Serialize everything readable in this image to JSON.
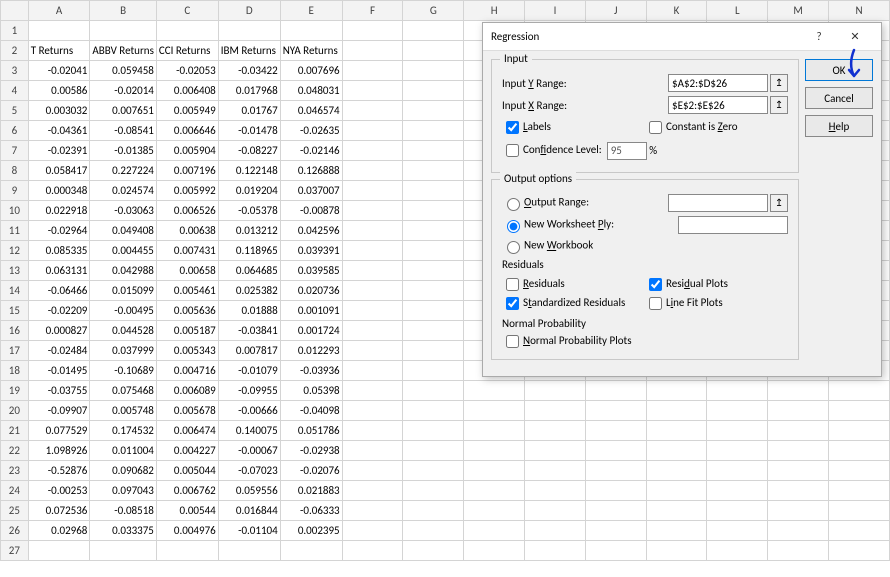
{
  "sheet": {
    "columns": [
      "A",
      "B",
      "C",
      "D",
      "E",
      "F",
      "G",
      "H",
      "I",
      "J",
      "K",
      "L",
      "M",
      "N"
    ],
    "rows": [
      {
        "n": 1,
        "cells": [
          "",
          "",
          "",
          "",
          "",
          "",
          "",
          "",
          "",
          "",
          "",
          "",
          "",
          ""
        ]
      },
      {
        "n": 2,
        "cells": [
          "T Returns",
          "ABBV Returns",
          "CCI Returns",
          "IBM Returns",
          "NYA Returns",
          "",
          "",
          "",
          "",
          "",
          "",
          "",
          "",
          ""
        ],
        "txt": true
      },
      {
        "n": 3,
        "cells": [
          "-0.02041",
          "0.059458",
          "-0.02053",
          "-0.03422",
          "0.007696",
          "",
          "",
          "",
          "",
          "",
          "",
          "",
          "",
          ""
        ]
      },
      {
        "n": 4,
        "cells": [
          "0.00586",
          "-0.02014",
          "0.006408",
          "0.017968",
          "0.048031",
          "",
          "",
          "",
          "",
          "",
          "",
          "",
          "",
          ""
        ]
      },
      {
        "n": 5,
        "cells": [
          "0.003032",
          "0.007651",
          "0.005949",
          "0.01767",
          "0.046574",
          "",
          "",
          "",
          "",
          "",
          "",
          "",
          "",
          ""
        ]
      },
      {
        "n": 6,
        "cells": [
          "-0.04361",
          "-0.08541",
          "0.006646",
          "-0.01478",
          "-0.02635",
          "",
          "",
          "",
          "",
          "",
          "",
          "",
          "",
          ""
        ]
      },
      {
        "n": 7,
        "cells": [
          "-0.02391",
          "-0.01385",
          "0.005904",
          "-0.08227",
          "-0.02146",
          "",
          "",
          "",
          "",
          "",
          "",
          "",
          "",
          ""
        ]
      },
      {
        "n": 8,
        "cells": [
          "0.058417",
          "0.227224",
          "0.007196",
          "0.122148",
          "0.126888",
          "",
          "",
          "",
          "",
          "",
          "",
          "",
          "",
          ""
        ]
      },
      {
        "n": 9,
        "cells": [
          "0.000348",
          "0.024574",
          "0.005992",
          "0.019204",
          "0.037007",
          "",
          "",
          "",
          "",
          "",
          "",
          "",
          "",
          ""
        ]
      },
      {
        "n": 10,
        "cells": [
          "0.022918",
          "-0.03063",
          "0.006526",
          "-0.05378",
          "-0.00878",
          "",
          "",
          "",
          "",
          "",
          "",
          "",
          "",
          ""
        ]
      },
      {
        "n": 11,
        "cells": [
          "-0.02964",
          "0.049408",
          "0.00638",
          "0.013212",
          "0.042596",
          "",
          "",
          "",
          "",
          "",
          "",
          "",
          "",
          ""
        ]
      },
      {
        "n": 12,
        "cells": [
          "0.085335",
          "0.004455",
          "0.007431",
          "0.118965",
          "0.039391",
          "",
          "",
          "",
          "",
          "",
          "",
          "",
          "",
          ""
        ]
      },
      {
        "n": 13,
        "cells": [
          "0.063131",
          "0.042988",
          "0.00658",
          "0.064685",
          "0.039585",
          "",
          "",
          "",
          "",
          "",
          "",
          "",
          "",
          ""
        ]
      },
      {
        "n": 14,
        "cells": [
          "-0.06466",
          "0.015099",
          "0.005461",
          "0.025382",
          "0.020736",
          "",
          "",
          "",
          "",
          "",
          "",
          "",
          "",
          ""
        ]
      },
      {
        "n": 15,
        "cells": [
          "-0.02209",
          "-0.00495",
          "0.005636",
          "0.01888",
          "0.001091",
          "",
          "",
          "",
          "",
          "",
          "",
          "",
          "",
          ""
        ]
      },
      {
        "n": 16,
        "cells": [
          "0.000827",
          "0.044528",
          "0.005187",
          "-0.03841",
          "0.001724",
          "",
          "",
          "",
          "",
          "",
          "",
          "",
          "",
          ""
        ]
      },
      {
        "n": 17,
        "cells": [
          "-0.02484",
          "0.037999",
          "0.005343",
          "0.007817",
          "0.012293",
          "",
          "",
          "",
          "",
          "",
          "",
          "",
          "",
          ""
        ]
      },
      {
        "n": 18,
        "cells": [
          "-0.01495",
          "-0.10689",
          "0.004716",
          "-0.01079",
          "-0.03936",
          "",
          "",
          "",
          "",
          "",
          "",
          "",
          "",
          ""
        ]
      },
      {
        "n": 19,
        "cells": [
          "-0.03755",
          "0.075468",
          "0.006089",
          "-0.09955",
          "0.05398",
          "",
          "",
          "",
          "",
          "",
          "",
          "",
          "",
          ""
        ]
      },
      {
        "n": 20,
        "cells": [
          "-0.09907",
          "0.005748",
          "0.005678",
          "-0.00666",
          "-0.04098",
          "",
          "",
          "",
          "",
          "",
          "",
          "",
          "",
          ""
        ]
      },
      {
        "n": 21,
        "cells": [
          "0.077529",
          "0.174532",
          "0.006474",
          "0.140075",
          "0.051786",
          "",
          "",
          "",
          "",
          "",
          "",
          "",
          "",
          ""
        ]
      },
      {
        "n": 22,
        "cells": [
          "1.098926",
          "0.011004",
          "0.004227",
          "-0.00067",
          "-0.02938",
          "",
          "",
          "",
          "",
          "",
          "",
          "",
          "",
          ""
        ]
      },
      {
        "n": 23,
        "cells": [
          "-0.52876",
          "0.090682",
          "0.005044",
          "-0.07023",
          "-0.02076",
          "",
          "",
          "",
          "",
          "",
          "",
          "",
          "",
          ""
        ]
      },
      {
        "n": 24,
        "cells": [
          "-0.00253",
          "0.097043",
          "0.006762",
          "0.059556",
          "0.021883",
          "",
          "",
          "",
          "",
          "",
          "",
          "",
          "",
          ""
        ]
      },
      {
        "n": 25,
        "cells": [
          "0.072536",
          "-0.08518",
          "0.00544",
          "0.016844",
          "-0.06333",
          "",
          "",
          "",
          "",
          "",
          "",
          "",
          "",
          ""
        ]
      },
      {
        "n": 26,
        "cells": [
          "0.02968",
          "0.033375",
          "0.004976",
          "-0.01104",
          "0.002395",
          "",
          "",
          "",
          "",
          "",
          "",
          "",
          "",
          ""
        ]
      },
      {
        "n": 27,
        "cells": [
          "",
          "",
          "",
          "",
          "",
          "",
          "",
          "",
          "",
          "",
          "",
          "",
          "",
          ""
        ]
      }
    ]
  },
  "dialog": {
    "title": "Regression",
    "help_q": "?",
    "close_x": "✕",
    "input_legend": "Input",
    "input_y_label": "Input Y Range:",
    "input_y_value": "$A$2:$D$26",
    "input_x_label": "Input X Range:",
    "input_x_value": "$E$2:$E$26",
    "labels_chk": "Labels",
    "constzero_chk": "Constant is Zero",
    "conflevel_chk": "Confidence Level:",
    "conflevel_value": "95",
    "conflevel_pct": "%",
    "output_legend": "Output options",
    "out_range": "Output Range:",
    "out_ws": "New Worksheet Ply:",
    "out_wb": "New Workbook",
    "residuals_legend": "Residuals",
    "resid": "Residuals",
    "stdresid": "Standardized Residuals",
    "residplots": "Residual Plots",
    "linefit": "Line Fit Plots",
    "normprob_legend": "Normal Probability",
    "normprob": "Normal Probability Plots",
    "ok": "OK",
    "cancel": "Cancel",
    "help": "Help",
    "pick_icon": "↥"
  },
  "annotation": "vb"
}
